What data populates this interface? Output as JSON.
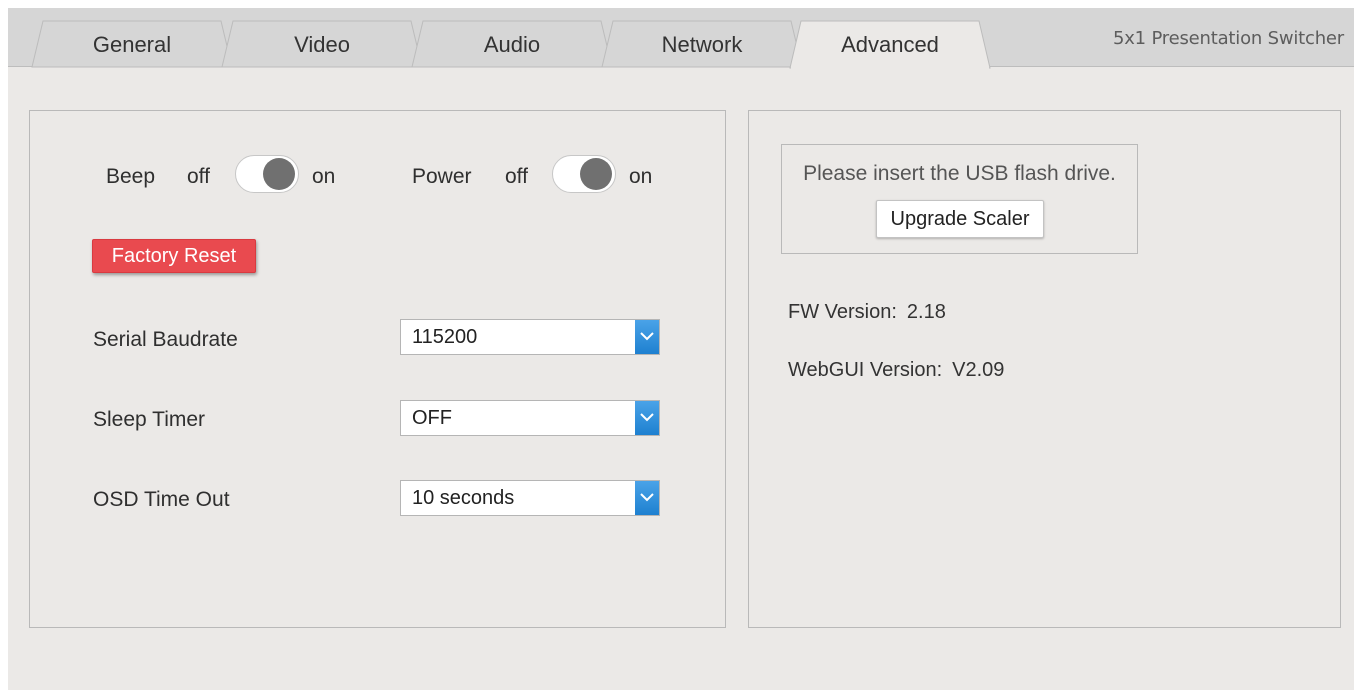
{
  "tabs": [
    {
      "label": "General",
      "active": false
    },
    {
      "label": "Video",
      "active": false
    },
    {
      "label": "Audio",
      "active": false
    },
    {
      "label": "Network",
      "active": false
    },
    {
      "label": "Advanced",
      "active": true
    }
  ],
  "product_title": "5x1 Presentation Switcher",
  "beep": {
    "label": "Beep",
    "off_label": "off",
    "on_label": "on",
    "state": "on"
  },
  "power": {
    "label": "Power",
    "off_label": "off",
    "on_label": "on",
    "state": "on"
  },
  "factory_reset_label": "Factory Reset",
  "settings": {
    "serial_baudrate": {
      "label": "Serial Baudrate",
      "value": "115200"
    },
    "sleep_timer": {
      "label": "Sleep Timer",
      "value": "OFF"
    },
    "osd_time_out": {
      "label": "OSD Time Out",
      "value": "10 seconds"
    }
  },
  "upgrade": {
    "message": "Please insert the USB flash drive.",
    "button_label": "Upgrade Scaler"
  },
  "info": {
    "fw_label": "FW Version:",
    "fw_value": "2.18",
    "webgui_label": "WebGUI Version:",
    "webgui_value": "V2.09"
  },
  "colors": {
    "factory_reset_bg": "#e94a4f",
    "select_arrow_bg": "#2a8ad8",
    "page_bg": "#ebe9e7",
    "tab_active_bg": "#ebe9e7",
    "tab_inactive_bg": "#d6d6d6"
  }
}
